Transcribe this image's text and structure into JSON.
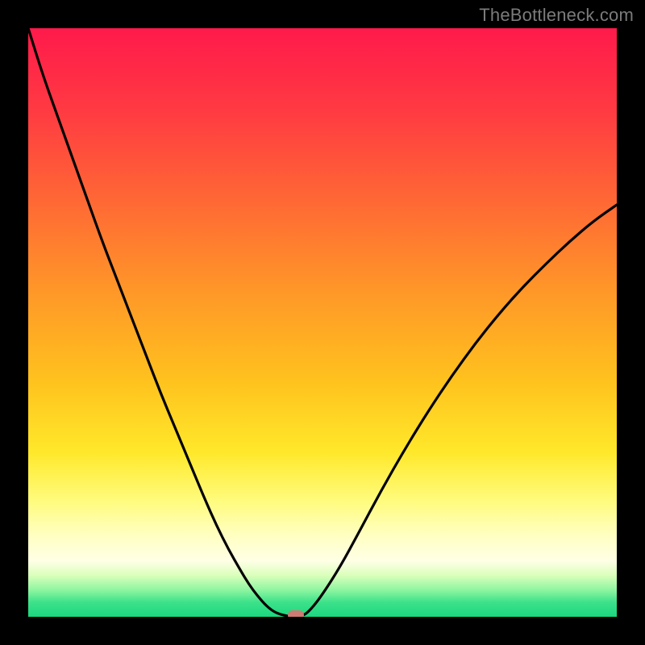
{
  "watermark": "TheBottleneck.com",
  "chart_data": {
    "type": "line",
    "title": "",
    "xlabel": "",
    "ylabel": "",
    "xlim": [
      0,
      100
    ],
    "ylim": [
      0,
      100
    ],
    "gradient_stops": [
      {
        "offset": 0,
        "color": "#ff1a4b"
      },
      {
        "offset": 0.14,
        "color": "#ff3a42"
      },
      {
        "offset": 0.3,
        "color": "#ff6a34"
      },
      {
        "offset": 0.45,
        "color": "#ff9828"
      },
      {
        "offset": 0.6,
        "color": "#ffc21e"
      },
      {
        "offset": 0.72,
        "color": "#ffe82a"
      },
      {
        "offset": 0.8,
        "color": "#fffb7a"
      },
      {
        "offset": 0.86,
        "color": "#ffffc0"
      },
      {
        "offset": 0.905,
        "color": "#ffffe6"
      },
      {
        "offset": 0.93,
        "color": "#d9ffba"
      },
      {
        "offset": 0.955,
        "color": "#8cf5a0"
      },
      {
        "offset": 0.975,
        "color": "#3de28a"
      },
      {
        "offset": 1.0,
        "color": "#19d77e"
      }
    ],
    "series": [
      {
        "name": "bottleneck-curve",
        "x": [
          0.0,
          2.5,
          5.0,
          7.5,
          10.0,
          12.5,
          15.0,
          17.5,
          20.0,
          22.5,
          25.0,
          27.5,
          30.0,
          32.0,
          34.0,
          36.0,
          37.5,
          39.0,
          40.5,
          42.1,
          44.5,
          46.5,
          48.0,
          50.0,
          53.0,
          56.0,
          60.0,
          64.0,
          68.0,
          72.0,
          76.0,
          80.0,
          84.0,
          88.0,
          92.0,
          96.0,
          100.0
        ],
        "y": [
          100.0,
          92.0,
          85.0,
          78.0,
          71.0,
          64.0,
          57.5,
          51.0,
          44.5,
          38.0,
          32.0,
          26.0,
          20.0,
          15.5,
          11.5,
          8.0,
          5.5,
          3.5,
          1.8,
          0.6,
          0.0,
          0.0,
          1.2,
          3.8,
          8.5,
          14.0,
          21.5,
          28.5,
          35.0,
          41.0,
          46.5,
          51.5,
          56.0,
          60.0,
          63.8,
          67.2,
          70.0
        ]
      }
    ],
    "marker": {
      "x": 45.5,
      "y": 0.0,
      "color": "#cf7a74"
    }
  }
}
